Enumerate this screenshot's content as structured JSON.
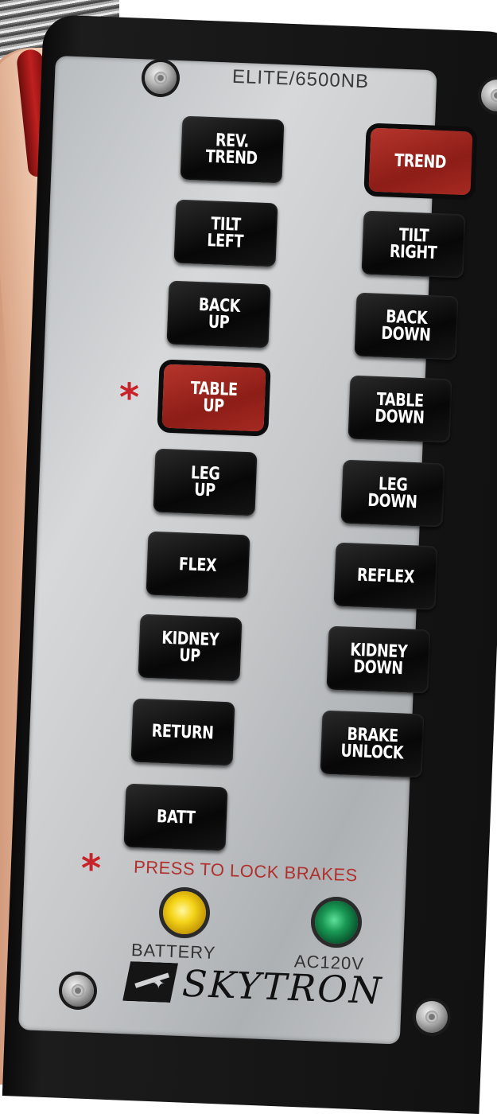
{
  "device": {
    "model": "ELITE/6500NB",
    "lock_note": "PRESS TO LOCK BRAKES",
    "asterisk": "*",
    "brand": "SKYTRON",
    "indicators": {
      "battery": "BATTERY",
      "ac": "AC120V"
    },
    "colors": {
      "red_button": "#9b231c",
      "asterisk": "#c8232a",
      "battery_led": "#f5d418",
      "ac_led": "#1a9a55"
    }
  },
  "buttons": {
    "rev_trend": "REV.\nTREND",
    "trend": "TREND",
    "tilt_left": "TILT\nLEFT",
    "tilt_right": "TILT\nRIGHT",
    "back_up": "BACK\nUP",
    "back_down": "BACK\nDOWN",
    "table_up": "TABLE\nUP",
    "table_down": "TABLE\nDOWN",
    "leg_up": "LEG\nUP",
    "leg_down": "LEG\nDOWN",
    "flex": "FLEX",
    "reflex": "REFLEX",
    "kidney_up": "KIDNEY\nUP",
    "kidney_down": "KIDNEY\nDOWN",
    "return": "RETURN",
    "brake_unlock": "BRAKE\nUNLOCK",
    "batt": "BATT"
  }
}
